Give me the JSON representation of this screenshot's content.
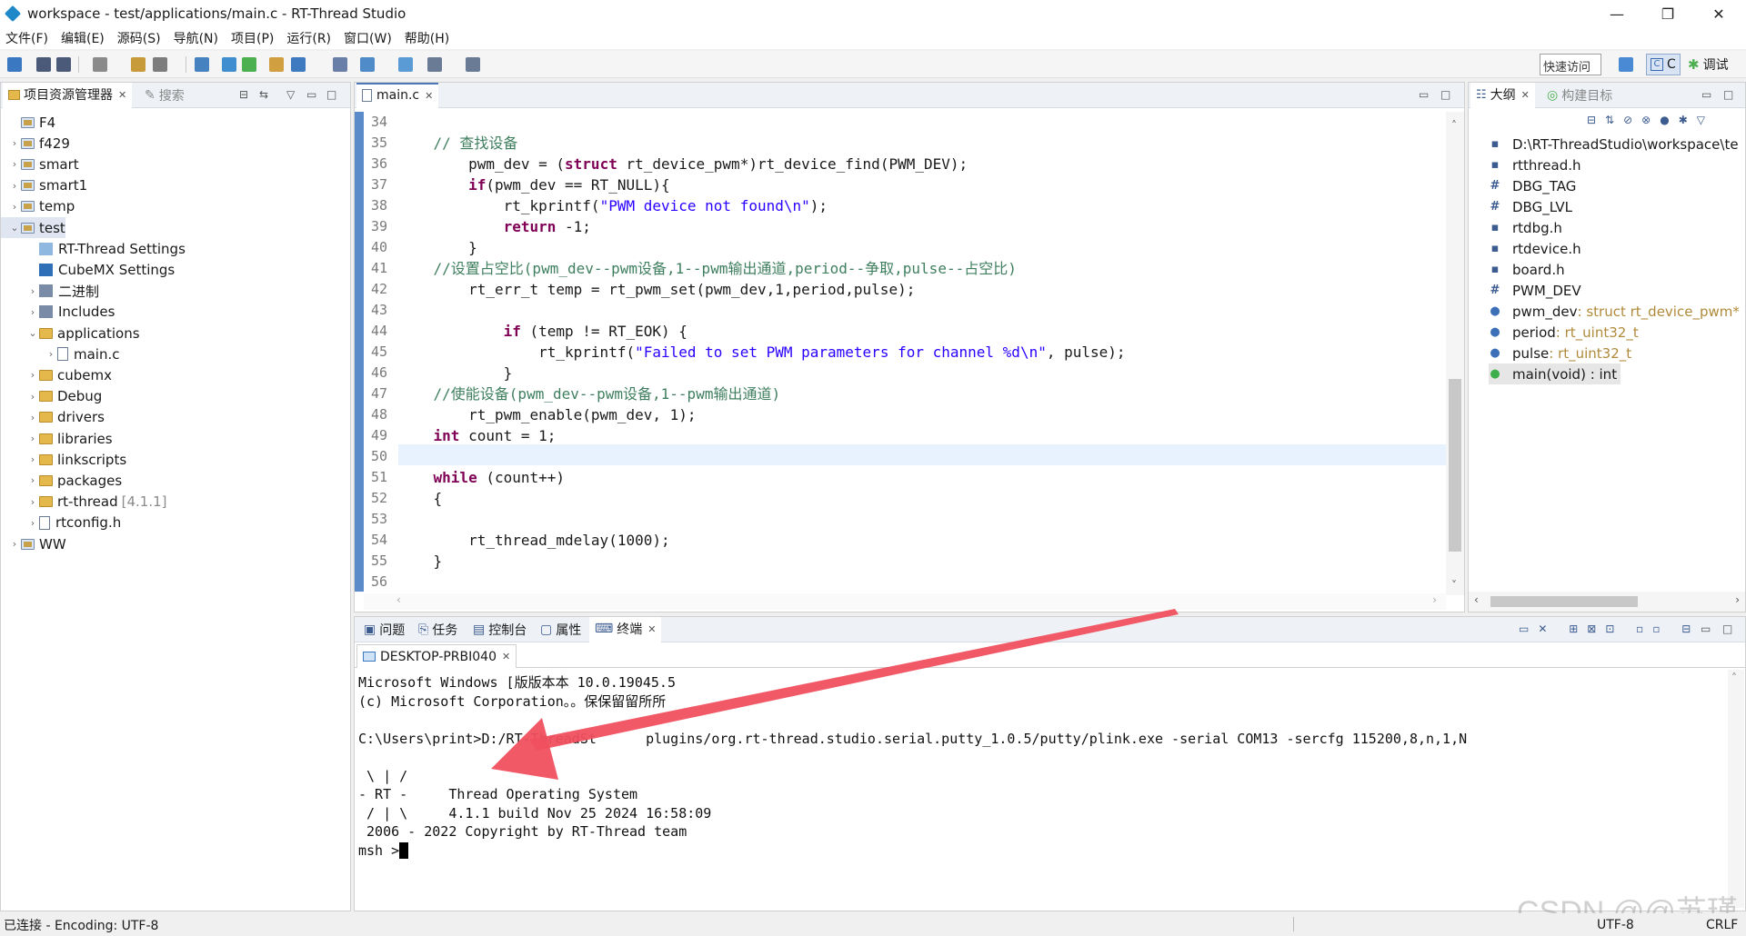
{
  "window": {
    "title": "workspace - test/applications/main.c - RT-Thread Studio"
  },
  "menu": [
    "文件(F)",
    "编辑(E)",
    "源码(S)",
    "导航(N)",
    "项目(P)",
    "运行(R)",
    "窗口(W)",
    "帮助(H)"
  ],
  "toolbar": {
    "quick_access": "快速访问",
    "perspective_c": "C",
    "perspective_debug": "调试"
  },
  "explorer": {
    "tab_label": "项目资源管理器",
    "search_tab": "搜索",
    "items": [
      {
        "label": "F4",
        "level": 0,
        "chevron": "",
        "icon": "proj"
      },
      {
        "label": "f429",
        "level": 0,
        "chevron": "›",
        "icon": "proj"
      },
      {
        "label": "smart",
        "level": 0,
        "chevron": "›",
        "icon": "proj"
      },
      {
        "label": "smart1",
        "level": 0,
        "chevron": "›",
        "icon": "proj"
      },
      {
        "label": "temp",
        "level": 0,
        "chevron": "›",
        "icon": "proj"
      },
      {
        "label": "test",
        "level": 0,
        "chevron": "⌄",
        "icon": "proj"
      },
      {
        "label": "RT-Thread Settings",
        "level": 1,
        "chevron": "",
        "icon": "rt"
      },
      {
        "label": "CubeMX Settings",
        "level": 1,
        "chevron": "",
        "icon": "mx"
      },
      {
        "label": "二进制",
        "level": 1,
        "chevron": "›",
        "icon": "bin"
      },
      {
        "label": "Includes",
        "level": 1,
        "chevron": "›",
        "icon": "inc"
      },
      {
        "label": "applications",
        "level": 1,
        "chevron": "⌄",
        "icon": "folder"
      },
      {
        "label": "main.c",
        "level": 2,
        "chevron": "›",
        "icon": "file"
      },
      {
        "label": "cubemx",
        "level": 1,
        "chevron": "›",
        "icon": "folder"
      },
      {
        "label": "Debug",
        "level": 1,
        "chevron": "›",
        "icon": "folder"
      },
      {
        "label": "drivers",
        "level": 1,
        "chevron": "›",
        "icon": "folder"
      },
      {
        "label": "libraries",
        "level": 1,
        "chevron": "›",
        "icon": "folder"
      },
      {
        "label": "linkscripts",
        "level": 1,
        "chevron": "›",
        "icon": "folder"
      },
      {
        "label": "packages",
        "level": 1,
        "chevron": "›",
        "icon": "folder"
      },
      {
        "label": "rt-thread",
        "level": 1,
        "chevron": "›",
        "icon": "folder",
        "suffix": "[4.1.1]"
      },
      {
        "label": "rtconfig.h",
        "level": 1,
        "chevron": "›",
        "icon": "file"
      },
      {
        "label": "WW",
        "level": 0,
        "chevron": "›",
        "icon": "proj"
      }
    ]
  },
  "editor": {
    "tab_label": "main.c",
    "lines": [
      {
        "n": "34",
        "html": ""
      },
      {
        "n": "35",
        "html": "    <span class=\"cm\">// 查找设备</span>"
      },
      {
        "n": "36",
        "html": "        pwm_dev = (<span class=\"kw\">struct</span> rt_device_pwm*)rt_device_find(PWM_DEV);"
      },
      {
        "n": "37",
        "html": "        <span class=\"kw\">if</span>(pwm_dev == RT_NULL){"
      },
      {
        "n": "38",
        "html": "            rt_kprintf(<span class=\"str\">\"PWM device not found\\n\"</span>);"
      },
      {
        "n": "39",
        "html": "            <span class=\"kw\">return</span> -1;"
      },
      {
        "n": "40",
        "html": "        }"
      },
      {
        "n": "41",
        "html": "    <span class=\"cm\">//设置占空比(pwm_dev--pwm设备,1--pwm输出通道,period--争取,pulse--占空比)</span>"
      },
      {
        "n": "42",
        "html": "        rt_err_t temp = rt_pwm_set(pwm_dev,1,period,pulse);"
      },
      {
        "n": "43",
        "html": ""
      },
      {
        "n": "44",
        "html": "            <span class=\"kw\">if</span> (temp != RT_EOK) {"
      },
      {
        "n": "45",
        "html": "                rt_kprintf(<span class=\"str\">\"Failed to set PWM parameters for channel %d\\n\"</span>, pulse);"
      },
      {
        "n": "46",
        "html": "            }"
      },
      {
        "n": "47",
        "html": "    <span class=\"cm\">//使能设备(pwm_dev--pwm设备,1--pwm输出通道)</span>"
      },
      {
        "n": "48",
        "html": "        rt_pwm_enable(pwm_dev, 1);"
      },
      {
        "n": "49",
        "html": "    <span class=\"kw\">int</span> count = 1;"
      },
      {
        "n": "50",
        "html": ""
      },
      {
        "n": "51",
        "html": "    <span class=\"kw\">while</span> (count++)"
      },
      {
        "n": "52",
        "html": "    {"
      },
      {
        "n": "53",
        "html": ""
      },
      {
        "n": "54",
        "html": "        rt_thread_mdelay(1000);"
      },
      {
        "n": "55",
        "html": "    }"
      },
      {
        "n": "56",
        "html": ""
      }
    ]
  },
  "outline": {
    "tab_label": "大纲",
    "build_tab": "构建目标",
    "items": [
      {
        "icon": "▪",
        "label": "D:\\RT-ThreadStudio\\workspace\\te",
        "type": ""
      },
      {
        "icon": "▪",
        "label": "rtthread.h",
        "type": ""
      },
      {
        "icon": "#",
        "label": "DBG_TAG",
        "type": ""
      },
      {
        "icon": "#",
        "label": "DBG_LVL",
        "type": ""
      },
      {
        "icon": "▪",
        "label": "rtdbg.h",
        "type": ""
      },
      {
        "icon": "▪",
        "label": "rtdevice.h",
        "type": ""
      },
      {
        "icon": "▪",
        "label": "board.h",
        "type": ""
      },
      {
        "icon": "#",
        "label": "PWM_DEV",
        "type": ""
      },
      {
        "icon": "●",
        "label": "pwm_dev",
        "type": " : struct rt_device_pwm*"
      },
      {
        "icon": "●",
        "label": "period",
        "type": " : rt_uint32_t"
      },
      {
        "icon": "●",
        "label": "pulse",
        "type": " : rt_uint32_t"
      },
      {
        "icon": "●",
        "label": "main(void) : int",
        "type": ""
      }
    ]
  },
  "bottom_tabs": [
    "问题",
    "任务",
    "控制台",
    "属性",
    "终端"
  ],
  "terminal": {
    "session_tab": "DESKTOP-PRBI040",
    "lines": [
      "Microsoft Windows [版版本本 10.0.19045.5",
      "(c) Microsoft Corporation。。保保留留所所",
      "",
      "C:\\Users\\print>D:/RT-ThreadSt      plugins/org.rt-thread.studio.serial.putty_1.0.5/putty/plink.exe -serial COM13 -sercfg 115200,8,n,1,N",
      "",
      " \\ | /",
      "- RT -     Thread Operating System",
      " / | \\     4.1.1 build Nov 25 2024 16:58:09",
      " 2006 - 2022 Copyright by RT-Thread team",
      "msh >"
    ]
  },
  "status": {
    "left": "已连接 - Encoding: UTF-8",
    "encoding": "UTF-8",
    "eol": "CRLF"
  },
  "watermark": "CSDN @@苏瑾",
  "colors": {
    "annotation_arrow": "#f0505f",
    "selection": "#dfe6f1",
    "current_line": "#e8f2fe"
  }
}
